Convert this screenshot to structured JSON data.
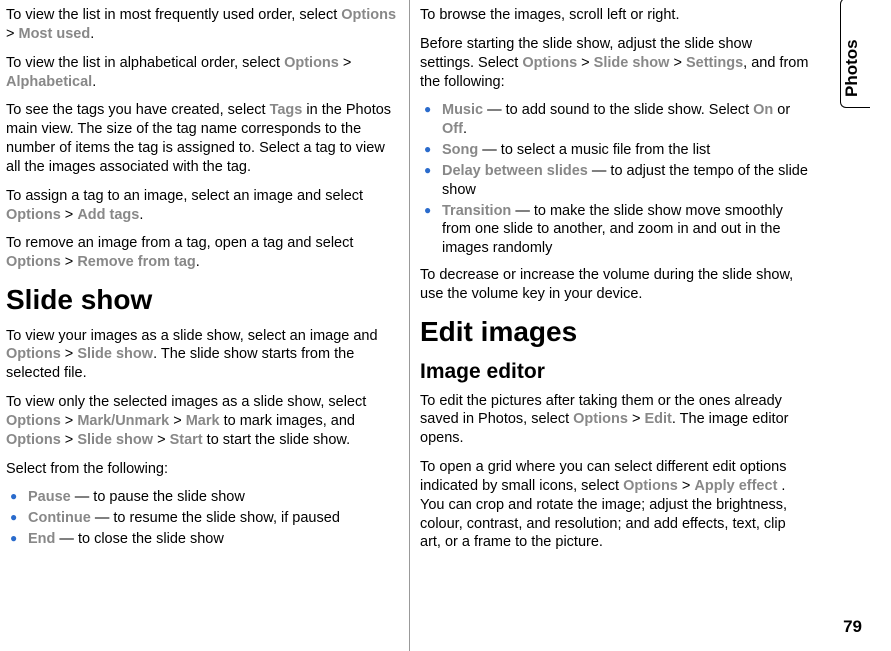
{
  "sidebar": {
    "tab_label": "Photos",
    "page_number": "79"
  },
  "col1": {
    "p1a": "To view the list in most frequently used order, select ",
    "p1b": "Options",
    "p1c": " > ",
    "p1d": "Most used",
    "p1e": ".",
    "p2a": "To view the list in alphabetical order, select ",
    "p2b": "Options",
    "p2c": " > ",
    "p2d": "Alphabetical",
    "p2e": ".",
    "p3a": "To see the tags you have created, select ",
    "p3b": "Tags",
    "p3c": " in the Photos main view. The size of the tag name corresponds to the number of items the tag is assigned to. Select a tag to view all the images associated with the tag.",
    "p4a": "To assign a tag to an image, select an image and select ",
    "p4b": "Options",
    "p4c": " > ",
    "p4d": "Add tags",
    "p4e": ".",
    "p5a": "To remove an image from a tag, open a tag and select ",
    "p5b": "Options",
    "p5c": " > ",
    "p5d": "Remove from tag",
    "p5e": ".",
    "h1": "Slide show",
    "p6a": "To view your images as a slide show, select an image and ",
    "p6b": "Options",
    "p6c": " > ",
    "p6d": "Slide show",
    "p6e": ". The slide show starts from the selected file.",
    "p7a": "To view only the selected images as a slide show, select ",
    "p7b": "Options",
    "p7c": " > ",
    "p7d": "Mark/Unmark",
    "p7e": " > ",
    "p7f": "Mark",
    "p7g": " to mark images, and ",
    "p7h": "Options",
    "p7i": " > ",
    "p7j": "Slide show",
    "p7k": " > ",
    "p7l": "Start",
    "p7m": " to start the slide show.",
    "p8": "Select from the following:",
    "bullets": [
      {
        "label": "Pause",
        "text": "  — to pause the slide show"
      },
      {
        "label": "Continue",
        "text": "  — to resume the slide show, if paused"
      },
      {
        "label": "End",
        "text": "  — to close the slide show"
      }
    ]
  },
  "col2": {
    "p1": "To browse the images, scroll left or right.",
    "p2a": "Before starting the slide show, adjust the slide show settings. Select ",
    "p2b": "Options",
    "p2c": " > ",
    "p2d": "Slide show",
    "p2e": " > ",
    "p2f": "Settings",
    "p2g": ", and from the following:",
    "bullets": [
      {
        "label": "Music",
        "mid": "  — to add sound to the slide show. Select ",
        "opt1": "On",
        "or": " or ",
        "opt2": "Off",
        "end": "."
      },
      {
        "label": "Song",
        "text": "  — to select a music file from the list"
      },
      {
        "label": "Delay between slides",
        "text": "  — to adjust the tempo of the slide show"
      },
      {
        "label": "Transition",
        "text": "  — to make the slide show move smoothly from one slide to another, and zoom in and out in the images randomly"
      }
    ],
    "p3": "To decrease or increase the volume during the slide show, use the volume key in your device.",
    "h1": "Edit images",
    "h2": "Image editor",
    "p4a": "To edit the pictures after taking them or the ones already saved in Photos, select ",
    "p4b": "Options",
    "p4c": " > ",
    "p4d": "Edit",
    "p4e": ". The image editor opens.",
    "p5a": "To open a grid where you can select different edit options indicated by small icons, select ",
    "p5b": "Options",
    "p5c": " > ",
    "p5d": "Apply effect",
    "p5e": " . You can crop and rotate the image; adjust the brightness, colour, contrast, and resolution; and add effects, text, clip art, or a frame to the picture."
  }
}
